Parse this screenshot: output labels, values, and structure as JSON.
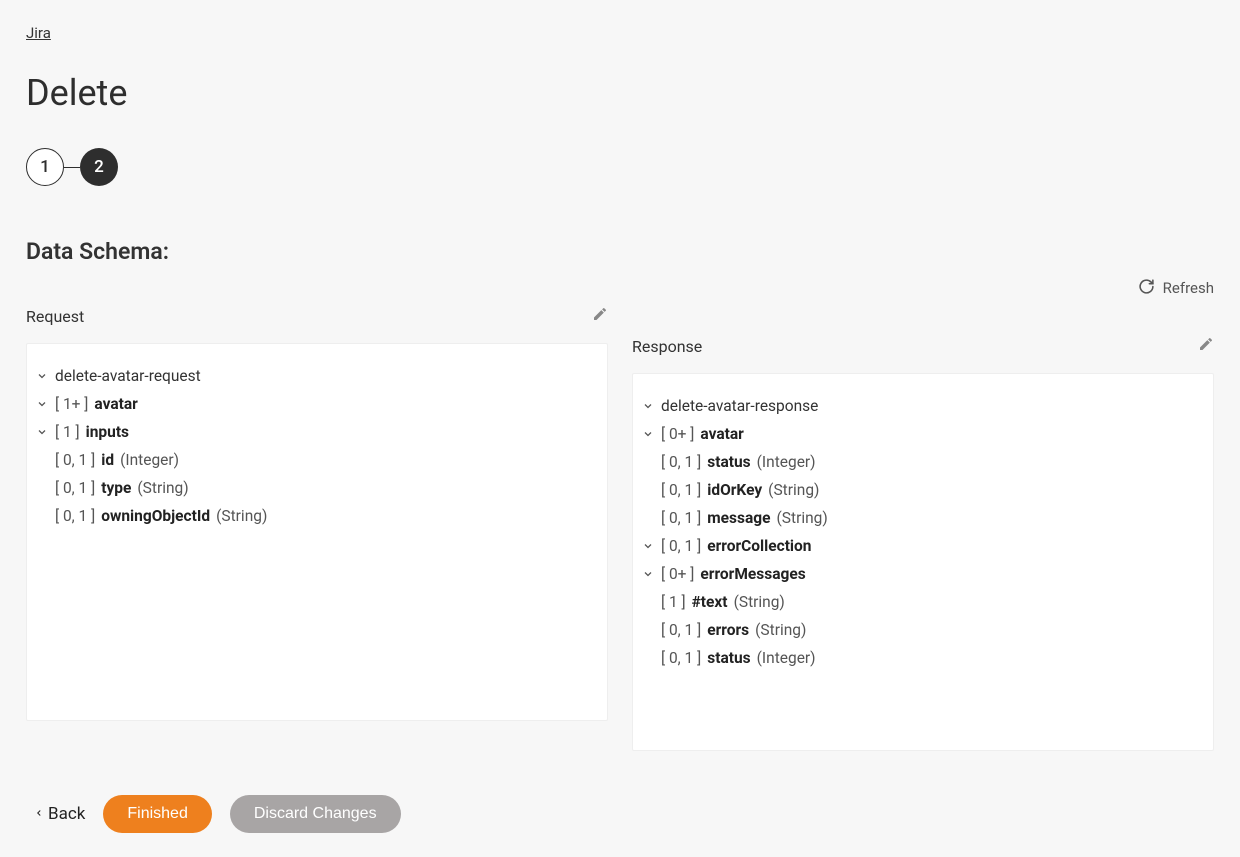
{
  "breadcrumb": "Jira",
  "title": "Delete",
  "stepper": {
    "steps": [
      "1",
      "2"
    ],
    "activeIndex": 1
  },
  "section_title": "Data Schema:",
  "refresh_label": "Refresh",
  "request": {
    "label": "Request",
    "tree": [
      {
        "indent": 0,
        "chevron": true,
        "card": "",
        "name": "delete-avatar-request",
        "bold": false,
        "type": ""
      },
      {
        "indent": 1,
        "chevron": true,
        "card": "[ 1+ ]",
        "name": "avatar",
        "bold": true,
        "type": ""
      },
      {
        "indent": 2,
        "chevron": true,
        "card": "[ 1 ]",
        "name": "inputs",
        "bold": true,
        "type": ""
      },
      {
        "indent": 3,
        "chevron": false,
        "card": "[ 0, 1 ]",
        "name": "id",
        "bold": true,
        "type": "(Integer)"
      },
      {
        "indent": 3,
        "chevron": false,
        "card": "[ 0, 1 ]",
        "name": "type",
        "bold": true,
        "type": "(String)"
      },
      {
        "indent": 3,
        "chevron": false,
        "card": "[ 0, 1 ]",
        "name": "owningObjectId",
        "bold": true,
        "type": "(String)"
      }
    ]
  },
  "response": {
    "label": "Response",
    "tree": [
      {
        "indent": 0,
        "chevron": true,
        "card": "",
        "name": "delete-avatar-response",
        "bold": false,
        "type": ""
      },
      {
        "indent": 1,
        "chevron": true,
        "card": "[ 0+ ]",
        "name": "avatar",
        "bold": true,
        "type": ""
      },
      {
        "indent": 2,
        "chevron": false,
        "card": "[ 0, 1 ]",
        "name": "status",
        "bold": true,
        "type": "(Integer)"
      },
      {
        "indent": 2,
        "chevron": false,
        "card": "[ 0, 1 ]",
        "name": "idOrKey",
        "bold": true,
        "type": "(String)"
      },
      {
        "indent": 2,
        "chevron": false,
        "card": "[ 0, 1 ]",
        "name": "message",
        "bold": true,
        "type": "(String)"
      },
      {
        "indent": 2,
        "chevron": true,
        "card": "[ 0, 1 ]",
        "name": "errorCollection",
        "bold": true,
        "type": ""
      },
      {
        "indent": 3,
        "chevron": true,
        "card": "[ 0+ ]",
        "name": "errorMessages",
        "bold": true,
        "type": ""
      },
      {
        "indent": 4,
        "chevron": false,
        "card": "[ 1 ]",
        "name": "#text",
        "bold": true,
        "type": "(String)"
      },
      {
        "indent": 3,
        "chevron": false,
        "card": "[ 0, 1 ]",
        "name": "errors",
        "bold": true,
        "type": "(String)"
      },
      {
        "indent": 3,
        "chevron": false,
        "card": "[ 0, 1 ]",
        "name": "status",
        "bold": true,
        "type": "(Integer)"
      }
    ]
  },
  "footer": {
    "back": "Back",
    "finished": "Finished",
    "discard": "Discard Changes"
  }
}
